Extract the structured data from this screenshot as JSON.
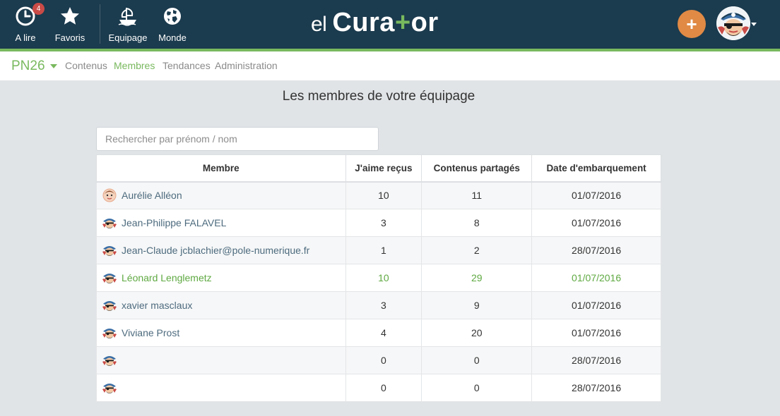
{
  "header": {
    "nav": [
      {
        "label": "A lire",
        "icon": "clock-icon",
        "badge": "4"
      },
      {
        "label": "Favoris",
        "icon": "star-icon"
      },
      {
        "label": "Equipage",
        "icon": "ship-icon"
      },
      {
        "label": "Monde",
        "icon": "globe-icon"
      }
    ],
    "logo": {
      "prefix": "el",
      "part1": "Cura",
      "plus": "+",
      "part2": "or"
    },
    "add_button": "+",
    "colors": {
      "bar": "#1b3b4e",
      "accent": "#79b95e",
      "add": "#e08a45"
    }
  },
  "subnav": {
    "team": "PN26",
    "links": [
      "Contenus",
      "Membres",
      "Tendances",
      "Administration"
    ],
    "active": "Membres"
  },
  "main": {
    "title": "Les membres de votre équipage",
    "search_placeholder": "Rechercher par prénom / nom",
    "columns": [
      "Membre",
      "J'aime reçus",
      "Contenus partagés",
      "Date d'embarquement"
    ],
    "rows": [
      {
        "name": "Aurélie Alléon",
        "likes": "10",
        "shared": "11",
        "date": "01/07/2016",
        "avatar": "girl-avatar-icon"
      },
      {
        "name": "Jean-Philippe FALAVEL",
        "likes": "3",
        "shared": "8",
        "date": "01/07/2016",
        "avatar": "pirate-avatar-icon"
      },
      {
        "name": "Jean-Claude jcblachier@pole-numerique.fr",
        "likes": "1",
        "shared": "2",
        "date": "28/07/2016",
        "avatar": "pirate-avatar-icon"
      },
      {
        "name": "Léonard Lenglemetz",
        "likes": "10",
        "shared": "29",
        "date": "01/07/2016",
        "avatar": "pirate-avatar-icon",
        "highlight": true
      },
      {
        "name": "xavier masclaux",
        "likes": "3",
        "shared": "9",
        "date": "01/07/2016",
        "avatar": "pirate-avatar-icon"
      },
      {
        "name": "Viviane Prost",
        "likes": "4",
        "shared": "20",
        "date": "01/07/2016",
        "avatar": "pirate-avatar-icon"
      },
      {
        "name": "",
        "likes": "0",
        "shared": "0",
        "date": "28/07/2016",
        "avatar": "pirate-avatar-icon"
      },
      {
        "name": "",
        "likes": "0",
        "shared": "0",
        "date": "28/07/2016",
        "avatar": "pirate-avatar-icon"
      }
    ]
  }
}
